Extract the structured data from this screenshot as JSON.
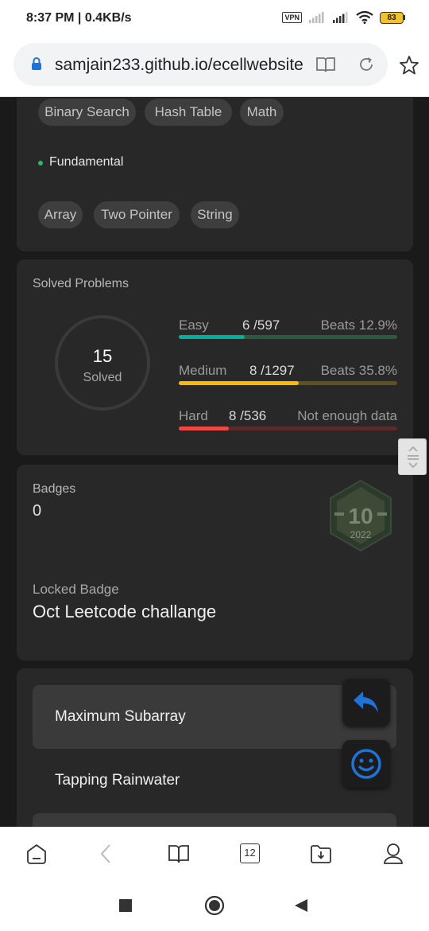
{
  "status_bar": {
    "time": "8:37 PM | 0.4KB/s",
    "vpn": "VPN",
    "battery": "83"
  },
  "browser": {
    "url": "samjain233.github.io/ecellwebsite",
    "tab_count": "12"
  },
  "skills": {
    "top_tags": [
      "Binary Search",
      "Hash Table",
      "Math"
    ],
    "fundamental_label": "Fundamental",
    "fundamental_tags": [
      "Array",
      "Two Pointer",
      "String"
    ]
  },
  "solved": {
    "title": "Solved Problems",
    "count": "15",
    "count_label": "Solved",
    "levels": [
      {
        "name": "Easy",
        "count": "6 /597",
        "beats": "Beats 12.9%",
        "progress": 0.3,
        "fill_color": "#00af9b",
        "track_color": "#2c5a3e"
      },
      {
        "name": "Medium",
        "count": "8 /1297",
        "beats": "Beats 35.8%",
        "progress": 0.55,
        "fill_color": "#ffb800",
        "track_color": "#5e5220"
      },
      {
        "name": "Hard",
        "count": "8 /536",
        "beats": "Not enough data",
        "progress": 0.23,
        "fill_color": "#ef4743",
        "track_color": "#5a2a2a"
      }
    ]
  },
  "badges": {
    "title": "Badges",
    "count": "0",
    "badge_number": "10",
    "badge_year": "2022",
    "locked_title": "Locked Badge",
    "locked_name": "Oct Leetcode challange"
  },
  "problems": {
    "items": [
      "Maximum Subarray",
      "Tapping Rainwater"
    ]
  },
  "colors": {
    "accent_blue": "#1e73d8",
    "easy": "#00af9b",
    "medium": "#ffb800",
    "hard": "#ef4743"
  }
}
